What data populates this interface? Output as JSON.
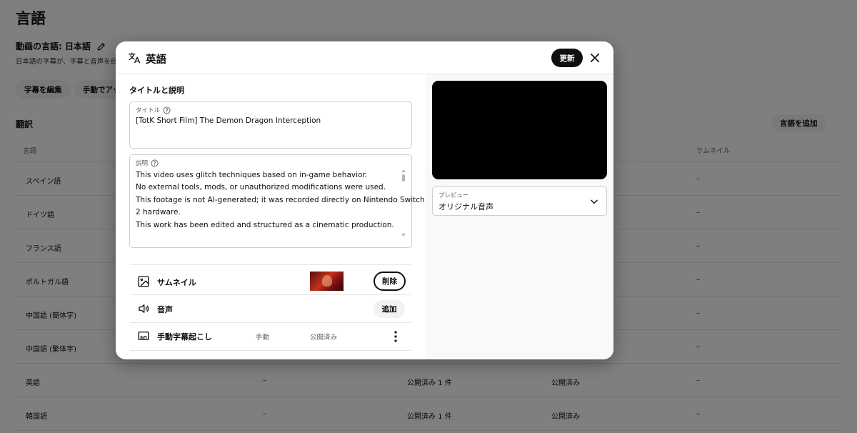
{
  "page": {
    "title": "言語",
    "video_language": "動画の言語: 日本語",
    "subtitle_note": "日本語の字幕が、字幕と音声を自",
    "chips": [
      "字幕を編集",
      "手動でアップ"
    ],
    "section_title": "翻訳",
    "add_language": "言語を追加",
    "columns": [
      "言語",
      "サムネイル"
    ],
    "rows": [
      {
        "lang": "スペイン語",
        "c2": "",
        "c3": "",
        "c4": "",
        "thumb": "–"
      },
      {
        "lang": "ドイツ語",
        "c2": "",
        "c3": "",
        "c4": "",
        "thumb": "–"
      },
      {
        "lang": "フランス語",
        "c2": "",
        "c3": "",
        "c4": "",
        "thumb": "–"
      },
      {
        "lang": "ポルトガル語",
        "c2": "",
        "c3": "",
        "c4": "",
        "thumb": "–"
      },
      {
        "lang": "中国語 (簡体字)",
        "c2": "",
        "c3": "",
        "c4": "",
        "thumb": "–"
      },
      {
        "lang": "中国語 (繁体字)",
        "c2": "",
        "c3": "",
        "c4": "",
        "thumb": "–"
      },
      {
        "lang": "英語",
        "c2": "–",
        "c3": "公開済み 1 件",
        "c4": "公開済み",
        "thumb": "–"
      },
      {
        "lang": "韓国語",
        "c2": "–",
        "c3": "公開済み 1 件",
        "c4": "公開済み",
        "thumb": "–"
      }
    ]
  },
  "dialog": {
    "title": "英語",
    "update_label": "更新",
    "section_label": "タイトルと説明",
    "title_field": {
      "label": "タイトル",
      "value": "[TotK Short Film] The Demon Dragon Interception"
    },
    "description_field": {
      "label": "説明",
      "lines": [
        "This video uses glitch techniques based on in-game behavior.",
        "No external tools, mods, or unauthorized modifications were used.",
        "This footage is not AI-generated; it was recorded directly on Nintendo Switch",
        "2 hardware.",
        "This work has been edited and structured as a cinematic production."
      ]
    },
    "items": {
      "thumbnail": {
        "label": "サムネイル",
        "delete_label": "削除"
      },
      "audio": {
        "label": "音声",
        "add_label": "追加"
      },
      "subtitles": {
        "label": "手動字幕起こし",
        "type": "手動",
        "status": "公開済み"
      }
    },
    "preview": {
      "label": "プレビュー",
      "value": "オリジナル音声"
    }
  },
  "colors": {
    "primary_button": "#0f0f0f",
    "chip_bg": "#f2f2f2",
    "overlay": "rgba(0,0,0,0.5)",
    "video_bg": "#000000"
  }
}
